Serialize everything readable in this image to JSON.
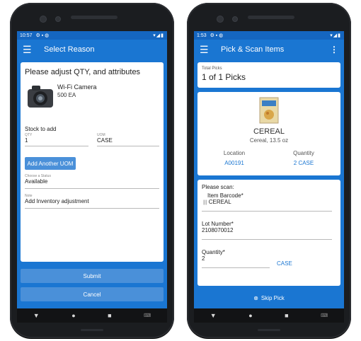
{
  "left": {
    "status": {
      "time": "10:57",
      "icons": "⚙ ▪ ◍",
      "signal": "▾◢▮"
    },
    "appbar": {
      "title": "Select Reason"
    },
    "heading": "Please adjust QTY, and attributes",
    "product": {
      "name": "Wi-Fi Camera",
      "qty": "500  EA"
    },
    "stock_label": "Stock to add",
    "qty": {
      "label": "QTY",
      "value": "1"
    },
    "uom": {
      "label": "UOM",
      "value": "CASE"
    },
    "add_uom_button": "Add Another UOM",
    "status_field": {
      "label": "Choose a Status",
      "value": "Available"
    },
    "note_field": {
      "label": "Note",
      "value": "Add Inventory adjustment"
    },
    "submit_button": "Submit",
    "cancel_button": "Cancel"
  },
  "right": {
    "status": {
      "time": "1:53",
      "icons": "⚙ ▪ ◍",
      "signal": "▾◢▮"
    },
    "appbar": {
      "title": "Pick & Scan Items"
    },
    "total_picks": {
      "label": "Total Picks",
      "value": "1 of 1 Picks"
    },
    "item": {
      "name": "CEREAL",
      "desc": "Cereal, 13.5 oz"
    },
    "location": {
      "label": "Location",
      "value": "A00191"
    },
    "quantity": {
      "label": "Quantity",
      "value": "2 CASE"
    },
    "please_scan": "Please scan:",
    "item_barcode": {
      "label": "Item Barcode*",
      "value": "CEREAL"
    },
    "lot_number": {
      "label": "Lot Number*",
      "value": "2108070012"
    },
    "qty_field": {
      "label": "Quantity*",
      "value": "2",
      "unit": "CASE"
    },
    "skip_button": "Skip Pick"
  },
  "navbar": {
    "back": "▼",
    "home": "●",
    "recent": "■",
    "keyboard": "⌨"
  },
  "colors": {
    "primary": "#1a76d2",
    "button": "#4a90d9",
    "link": "#1a76d2"
  }
}
